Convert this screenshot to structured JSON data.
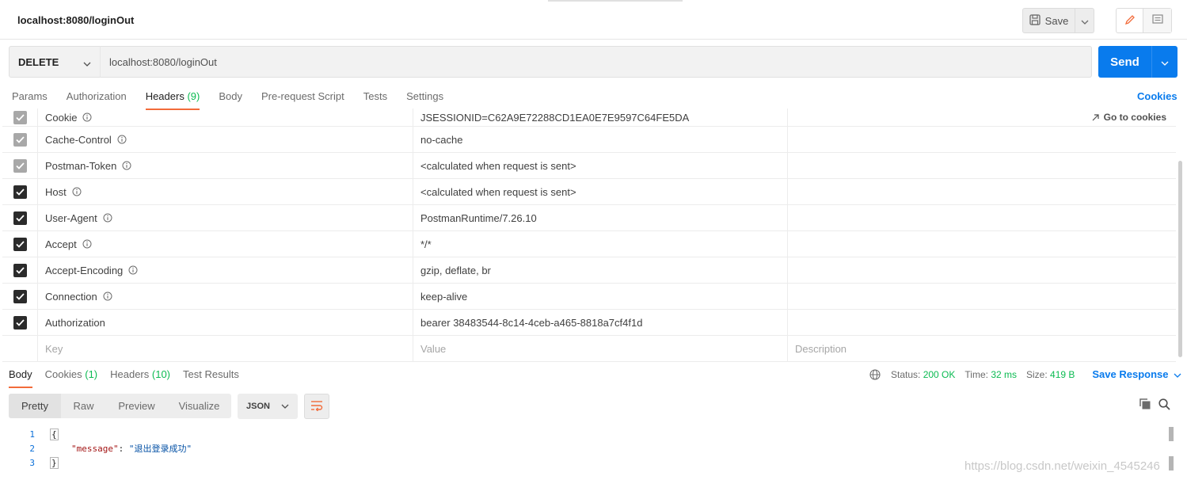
{
  "request": {
    "title": "localhost:8080/loginOut",
    "save_label": "Save",
    "method": "DELETE",
    "url": "localhost:8080/loginOut",
    "send_label": "Send"
  },
  "request_tabs": [
    {
      "label": "Params"
    },
    {
      "label": "Authorization"
    },
    {
      "label": "Headers",
      "count": "(9)",
      "active": true
    },
    {
      "label": "Body"
    },
    {
      "label": "Pre-request Script"
    },
    {
      "label": "Tests"
    },
    {
      "label": "Settings"
    }
  ],
  "cookies_link": "Cookies",
  "go_to_cookies": "Go to cookies",
  "headers": [
    {
      "key": "Cookie",
      "value": "JSESSIONID=C62A9E72288CD1EA0E7E9597C64FE5DA",
      "checked": true,
      "disabled": true,
      "info": true
    },
    {
      "key": "Cache-Control",
      "value": "no-cache",
      "checked": true,
      "disabled": true,
      "info": true
    },
    {
      "key": "Postman-Token",
      "value": "<calculated when request is sent>",
      "checked": true,
      "disabled": true,
      "info": true
    },
    {
      "key": "Host",
      "value": "<calculated when request is sent>",
      "checked": true,
      "disabled": false,
      "info": true
    },
    {
      "key": "User-Agent",
      "value": "PostmanRuntime/7.26.10",
      "checked": true,
      "disabled": false,
      "info": true
    },
    {
      "key": "Accept",
      "value": "*/*",
      "checked": true,
      "disabled": false,
      "info": true
    },
    {
      "key": "Accept-Encoding",
      "value": "gzip, deflate, br",
      "checked": true,
      "disabled": false,
      "info": true
    },
    {
      "key": "Connection",
      "value": "keep-alive",
      "checked": true,
      "disabled": false,
      "info": true
    },
    {
      "key": "Authorization",
      "value": "bearer 38483544-8c14-4ceb-a465-8818a7cf4f1d",
      "checked": true,
      "disabled": false,
      "info": false
    }
  ],
  "new_header": {
    "key_placeholder": "Key",
    "value_placeholder": "Value",
    "description_placeholder": "Description"
  },
  "response_tabs": [
    {
      "label": "Body",
      "active": true
    },
    {
      "label": "Cookies",
      "count": "(1)"
    },
    {
      "label": "Headers",
      "count": "(10)"
    },
    {
      "label": "Test Results"
    }
  ],
  "response_meta": {
    "status_label": "Status:",
    "status_value": "200 OK",
    "time_label": "Time:",
    "time_value": "32 ms",
    "size_label": "Size:",
    "size_value": "419 B",
    "save_response": "Save Response"
  },
  "view_modes": [
    {
      "label": "Pretty",
      "active": true
    },
    {
      "label": "Raw"
    },
    {
      "label": "Preview"
    },
    {
      "label": "Visualize"
    }
  ],
  "format": "JSON",
  "response_body": {
    "line_numbers": [
      "1",
      "2",
      "3"
    ],
    "open_brace": "{",
    "key": "\"message\"",
    "colon": ": ",
    "value": "\"退出登录成功\"",
    "close_brace": "}"
  },
  "watermark": "https://blog.csdn.net/weixin_4545246",
  "colors": {
    "accent": "#097bed",
    "tab_underline": "#f26b3a",
    "count_green": "#0cbb52"
  }
}
